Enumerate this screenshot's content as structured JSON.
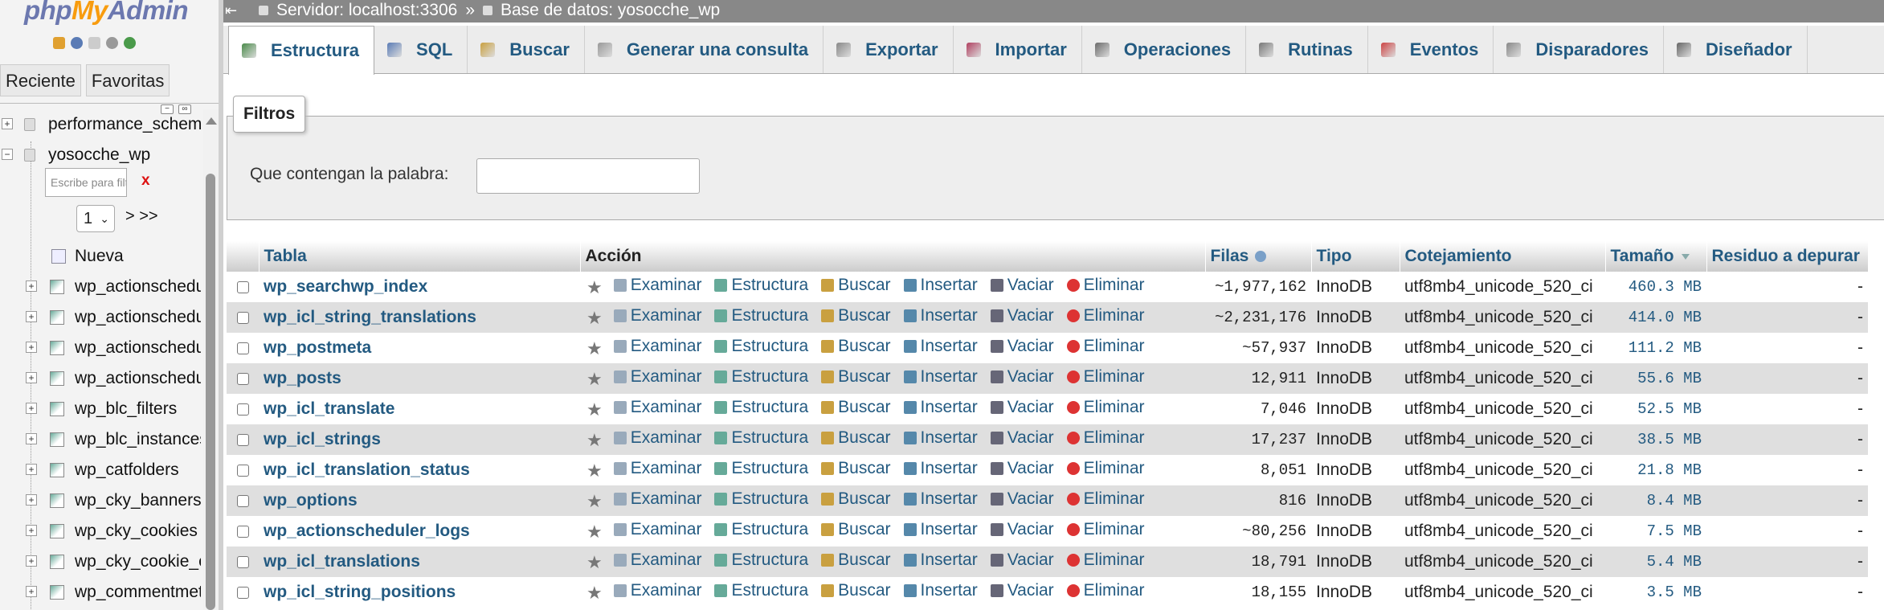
{
  "nav": {
    "logo_php": "php",
    "logo_my": "My",
    "logo_admin": "Admin",
    "tabs": [
      "Reciente",
      "Favoritas"
    ],
    "tree": {
      "db_performance": "performance_schema",
      "db_current": "yosocche_wp",
      "filter_placeholder": "Escribe para filtrar",
      "filter_clear": "x",
      "page_value": "1",
      "page_next": "> >>",
      "new_item": "Nueva",
      "tables": [
        "wp_actionscheduler_actions",
        "wp_actionscheduler_claims",
        "wp_actionscheduler_groups",
        "wp_actionscheduler_logs",
        "wp_blc_filters",
        "wp_blc_instances",
        "wp_catfolders",
        "wp_cky_banners",
        "wp_cky_cookies",
        "wp_cky_cookie_categories",
        "wp_commentmeta"
      ]
    }
  },
  "topbar": {
    "server": "Servidor: localhost:3306",
    "separator": "»",
    "database": "Base de datos: yosocche_wp"
  },
  "main_tabs": [
    {
      "label": "Estructura",
      "icon": "structure-icon"
    },
    {
      "label": "SQL",
      "icon": "sql-icon"
    },
    {
      "label": "Buscar",
      "icon": "search-icon"
    },
    {
      "label": "Generar una consulta",
      "icon": "query-icon"
    },
    {
      "label": "Exportar",
      "icon": "export-icon"
    },
    {
      "label": "Importar",
      "icon": "import-icon"
    },
    {
      "label": "Operaciones",
      "icon": "operations-icon"
    },
    {
      "label": "Rutinas",
      "icon": "routines-icon"
    },
    {
      "label": "Eventos",
      "icon": "events-icon"
    },
    {
      "label": "Disparadores",
      "icon": "triggers-icon"
    },
    {
      "label": "Diseñador",
      "icon": "designer-icon"
    }
  ],
  "filters": {
    "legend": "Filtros",
    "label": "Que contengan la palabra:",
    "value": ""
  },
  "table": {
    "headers": {
      "name": "Tabla",
      "action": "Acción",
      "rows": "Filas",
      "type": "Tipo",
      "collation": "Cotejamiento",
      "size": "Tamaño",
      "overhead": "Residuo a depurar"
    },
    "actions": {
      "browse": "Examinar",
      "structure": "Estructura",
      "search": "Buscar",
      "insert": "Insertar",
      "empty": "Vaciar",
      "drop": "Eliminar"
    },
    "rows": [
      {
        "name": "wp_searchwp_index",
        "rows": "~1,977,162",
        "type": "InnoDB",
        "collation": "utf8mb4_unicode_520_ci",
        "size": "460.3 MB",
        "overhead": "-"
      },
      {
        "name": "wp_icl_string_translations",
        "rows": "~2,231,176",
        "type": "InnoDB",
        "collation": "utf8mb4_unicode_520_ci",
        "size": "414.0 MB",
        "overhead": "-"
      },
      {
        "name": "wp_postmeta",
        "rows": "~57,937",
        "type": "InnoDB",
        "collation": "utf8mb4_unicode_520_ci",
        "size": "111.2 MB",
        "overhead": "-"
      },
      {
        "name": "wp_posts",
        "rows": "12,911",
        "type": "InnoDB",
        "collation": "utf8mb4_unicode_520_ci",
        "size": "55.6 MB",
        "overhead": "-"
      },
      {
        "name": "wp_icl_translate",
        "rows": "7,046",
        "type": "InnoDB",
        "collation": "utf8mb4_unicode_520_ci",
        "size": "52.5 MB",
        "overhead": "-"
      },
      {
        "name": "wp_icl_strings",
        "rows": "17,237",
        "type": "InnoDB",
        "collation": "utf8mb4_unicode_520_ci",
        "size": "38.5 MB",
        "overhead": "-"
      },
      {
        "name": "wp_icl_translation_status",
        "rows": "8,051",
        "type": "InnoDB",
        "collation": "utf8mb4_unicode_520_ci",
        "size": "21.8 MB",
        "overhead": "-"
      },
      {
        "name": "wp_options",
        "rows": "816",
        "type": "InnoDB",
        "collation": "utf8mb4_unicode_520_ci",
        "size": "8.4 MB",
        "overhead": "-"
      },
      {
        "name": "wp_actionscheduler_logs",
        "rows": "~80,256",
        "type": "InnoDB",
        "collation": "utf8mb4_unicode_520_ci",
        "size": "7.5 MB",
        "overhead": "-"
      },
      {
        "name": "wp_icl_translations",
        "rows": "18,791",
        "type": "InnoDB",
        "collation": "utf8mb4_unicode_520_ci",
        "size": "5.4 MB",
        "overhead": "-"
      },
      {
        "name": "wp_icl_string_positions",
        "rows": "18,155",
        "type": "InnoDB",
        "collation": "utf8mb4_unicode_520_ci",
        "size": "3.5 MB",
        "overhead": "-"
      }
    ]
  }
}
